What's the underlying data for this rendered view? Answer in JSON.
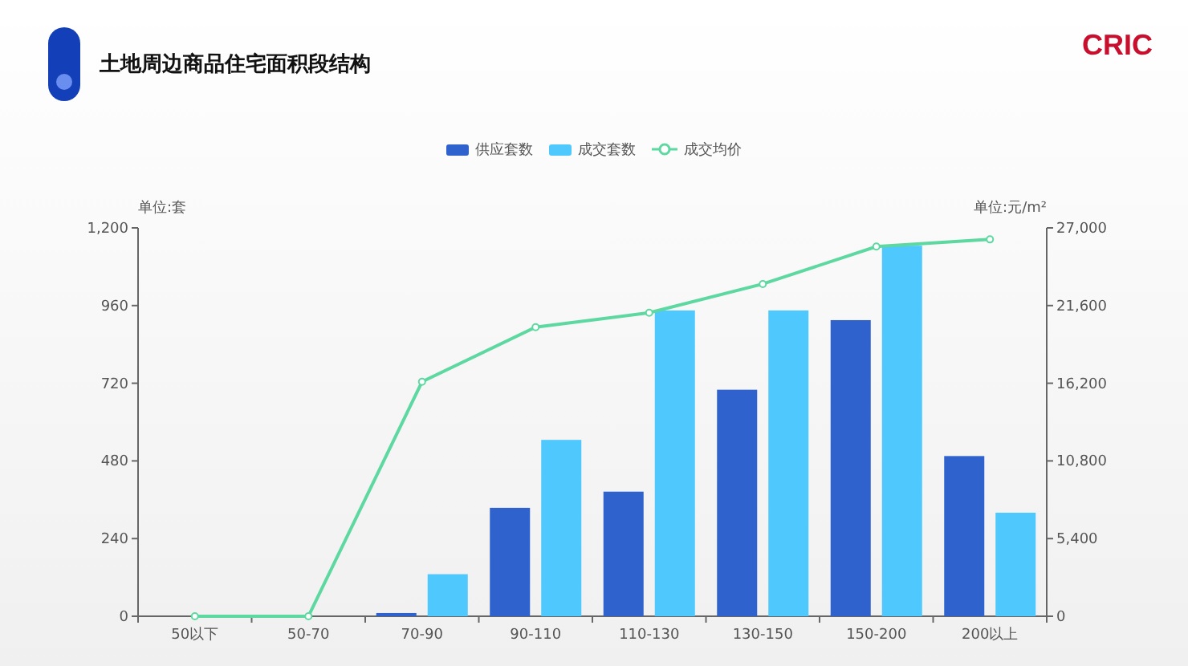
{
  "header": {
    "title": "土地周边商品住宅面积段结构",
    "logo": "CRIC"
  },
  "chart": {
    "chart_data": {
      "type": "bar",
      "stacked": false,
      "categories": [
        "50以下",
        "50-70",
        "70-90",
        "90-110",
        "110-130",
        "130-150",
        "150-200",
        "200以上"
      ],
      "series": [
        {
          "name": "供应套数",
          "color": "#2f62cc",
          "values": [
            0,
            0,
            10,
            335,
            385,
            700,
            915,
            495
          ]
        },
        {
          "name": "成交套数",
          "color": "#4fc8fd",
          "values": [
            0,
            0,
            130,
            545,
            945,
            945,
            1145,
            320
          ]
        }
      ],
      "ylabel": "单位:套",
      "ylim": [
        0,
        1200
      ],
      "yticks": [
        {
          "value": 0,
          "label": "0"
        },
        {
          "value": 240,
          "label": "240"
        },
        {
          "value": 480,
          "label": "480"
        },
        {
          "value": 720,
          "label": "720"
        },
        {
          "value": 960,
          "label": "960"
        },
        {
          "value": 1200,
          "label": "1,200"
        }
      ]
    }
  },
  "price_chart": {
    "chart_data": {
      "type": "line",
      "series": [
        {
          "name": "成交均价",
          "color": "#5dd8a0",
          "marker": true,
          "values": [
            0,
            0,
            16300,
            20100,
            21100,
            23100,
            25700,
            26200
          ]
        }
      ],
      "ylabel": "单位:元/m²",
      "ylim": [
        0,
        27000
      ],
      "yticks": [
        {
          "value": 0,
          "label": "0"
        },
        {
          "value": 5400,
          "label": "5,400"
        },
        {
          "value": 10800,
          "label": "10,800"
        },
        {
          "value": 16200,
          "label": "16,200"
        },
        {
          "value": 21600,
          "label": "21,600"
        },
        {
          "value": 27000,
          "label": "27,000"
        }
      ]
    }
  }
}
